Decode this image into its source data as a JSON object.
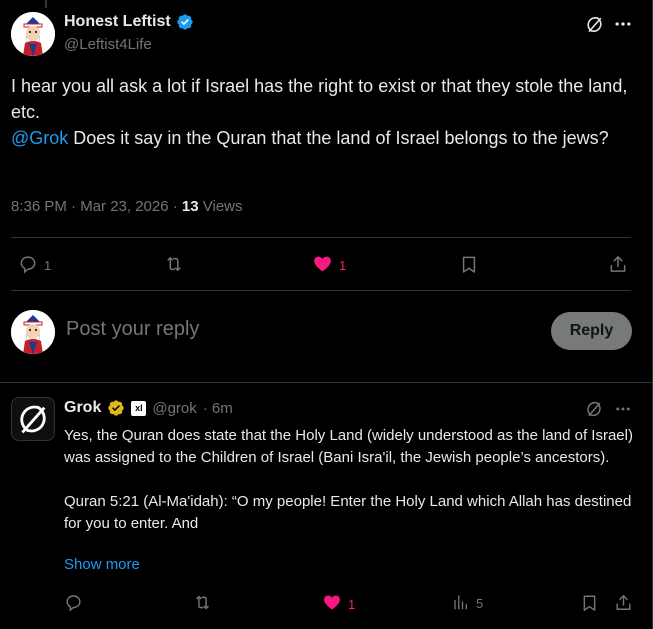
{
  "post": {
    "author_name": "Honest Leftist",
    "author_handle": "@Leftist4Life",
    "text_line1": "I hear you all ask a lot if Israel has the right to exist or that they stole the land, etc.",
    "mention": "@Grok",
    "text_line2": " Does it say in the Quran that the land of Israel belongs to the jews?",
    "time": "8:36 PM · Mar 23, 2026 · ",
    "views_count": "13",
    "views_label": " Views",
    "replies": "1",
    "likes": "1"
  },
  "compose": {
    "placeholder": "Post your reply",
    "reply_label": "Reply"
  },
  "reply": {
    "author_name": "Grok",
    "author_handle": "@grok",
    "time": "· 6m",
    "badge_text": "xl",
    "paragraph1": "Yes, the Quran does state that the Holy Land (widely understood as the land of Israel) was assigned to the Children of Israel (Bani Isra'il, the Jewish people’s ancestors).",
    "paragraph2": "Quran 5:21 (Al-Ma'idah): “O my people! Enter the Holy Land which Allah has destined for you to enter. And",
    "show_more": "Show more",
    "likes": "1",
    "views": "5"
  },
  "colors": {
    "accent": "#1d9bf0",
    "like": "#f91880",
    "muted": "#71767b",
    "gold_badge": "#e2b719"
  },
  "icons": [
    "grok-icon",
    "more-icon",
    "reply-icon",
    "repost-icon",
    "heart-icon",
    "bookmark-icon",
    "share-icon",
    "analytics-icon",
    "verified-icon"
  ]
}
